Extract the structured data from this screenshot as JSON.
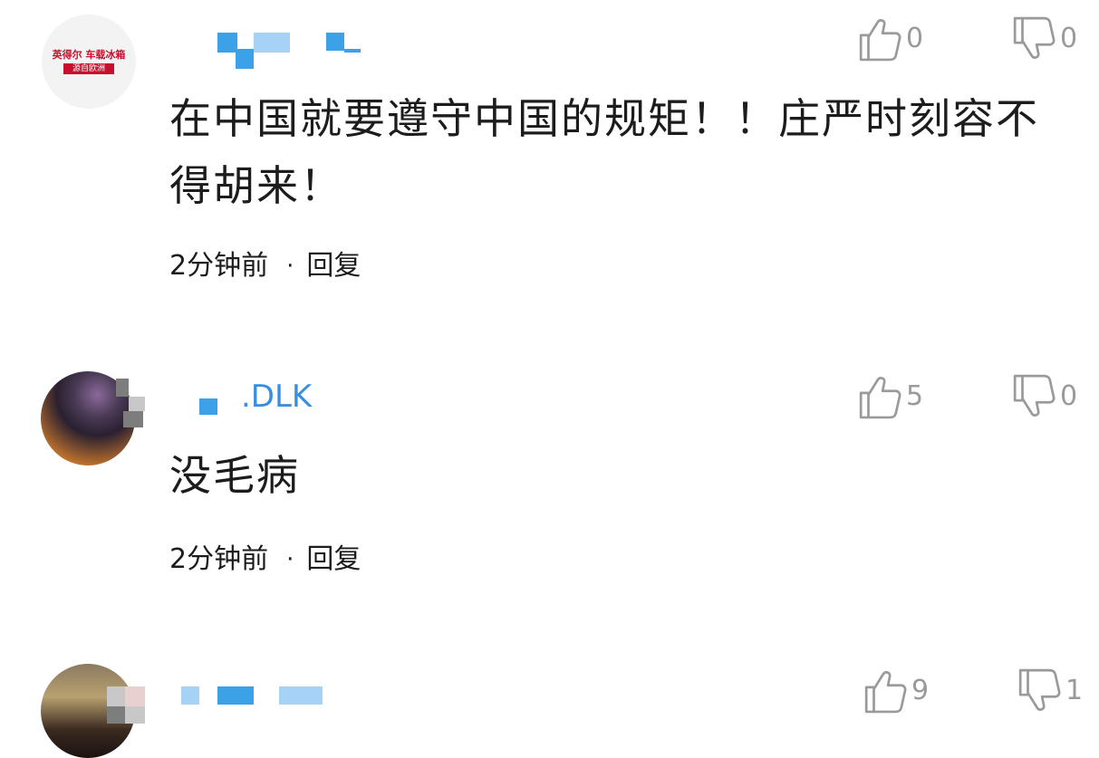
{
  "comments": [
    {
      "username": "",
      "avatar_brand": "英得尔 车载冰箱",
      "avatar_tagline": "源自欧洲",
      "likes": "0",
      "dislikes": "0",
      "text": "在中国就要遵守中国的规矩！！庄严时刻容不得胡来！",
      "time": "2分钟前",
      "reply_label": "回复"
    },
    {
      "username": ".DLK",
      "likes": "5",
      "dislikes": "0",
      "text": "没毛病",
      "time": "2分钟前",
      "reply_label": "回复"
    },
    {
      "username": "",
      "likes": "9",
      "dislikes": "1"
    }
  ],
  "separator": "·",
  "colors": {
    "username": "#3a8ee0",
    "text": "#1c1c1c",
    "icon": "#9a9a9a",
    "brand_red": "#c8102e"
  },
  "icons": {
    "like": "thumbs-up-icon",
    "dislike": "thumbs-down-icon"
  }
}
